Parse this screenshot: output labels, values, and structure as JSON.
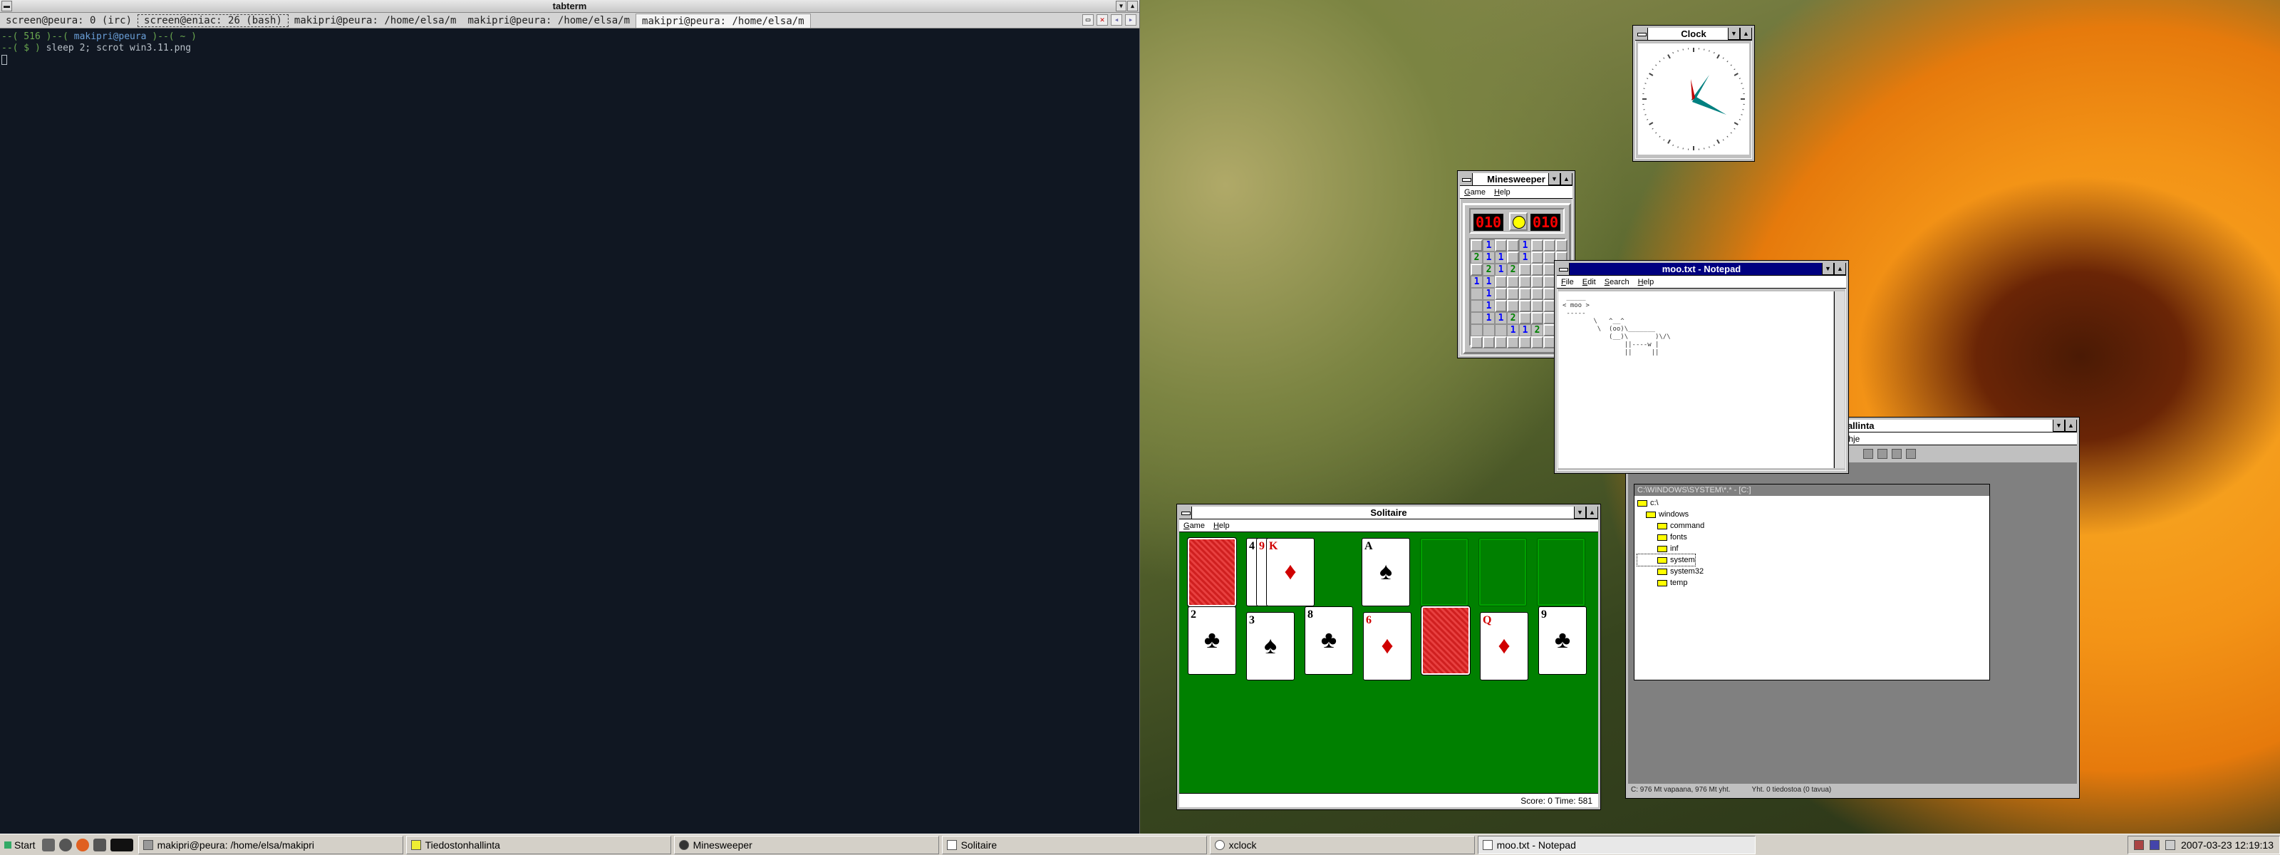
{
  "terminal": {
    "title": "tabterm",
    "tabs": [
      {
        "label": "screen@peura: 0 (irc)"
      },
      {
        "label": "screen@eniac: 26 (bash)"
      },
      {
        "label": "makipri@peura: /home/elsa/m"
      },
      {
        "label": "makipri@peura: /home/elsa/m"
      },
      {
        "label": "makipri@peura: /home/elsa/m"
      }
    ],
    "prompt_line1_a": "--( 516 )--( ",
    "prompt_user": "makipri@peura",
    "prompt_line1_b": " )--( ~ )",
    "prompt_line2_a": "--( $ ) ",
    "command": "sleep 2; scrot win3.11.png"
  },
  "clock": {
    "title": "Clock",
    "hour_angle": 112,
    "minute_angle": 76
  },
  "minesweeper": {
    "title": "Minesweeper",
    "menu": [
      "Game",
      "Help"
    ],
    "mines_left": "010",
    "time": "010",
    "rows": [
      "u1uu1uuu",
      "211u1uuu",
      "u212uuuu",
      "11uuuuuu",
      "o1uuuuuu",
      "o1uuuuuu",
      "o112uuuu",
      "ooo112u1",
      "uuuuuuuu"
    ]
  },
  "notepad": {
    "title": "moo.txt - Notepad",
    "menu": [
      "File",
      "Edit",
      "Search",
      "Help"
    ],
    "content": " _____\n< moo >\n -----\n        \\   ^__^\n         \\  (oo)\\_______\n            (__)\\       )\\/\\\n                ||----w |\n                ||     ||"
  },
  "file_manager": {
    "title": "Tiedostonhallinta",
    "title_visible": "hallinta",
    "menu_visible": "Ohje",
    "inner_title": "C:\\WINDOWS\\SYSTEM\\*.* - [C:]",
    "tree": [
      "c:\\",
      "windows",
      "command",
      "fonts",
      "inf",
      "system",
      "system32",
      "temp"
    ],
    "status_left": "C: 976 Mt vapaana, 976 Mt yht.",
    "status_right": "Yht. 0 tiedostoa (0 tavua)"
  },
  "solitaire": {
    "title": "Solitaire",
    "menu": [
      "Game",
      "Help"
    ],
    "status": "Score: 0 Time: 581",
    "waste": [
      {
        "rank": "4",
        "suit": "♣",
        "color": "black"
      },
      {
        "rank": "9",
        "suit": "♦",
        "color": "red"
      },
      {
        "rank": "K",
        "suit": "♦",
        "color": "red"
      }
    ],
    "foundation": {
      "rank": "A",
      "suit": "♠",
      "color": "black"
    },
    "tableau": [
      {
        "rank": "2",
        "suit": "♣",
        "color": "black"
      },
      {
        "rank": "3",
        "suit": "♠",
        "color": "black"
      },
      {
        "rank": "8",
        "suit": "♣",
        "color": "black"
      },
      {
        "rank": "6",
        "suit": "♦",
        "color": "red"
      },
      {
        "rank": "",
        "suit": "",
        "color": "back"
      },
      {
        "rank": "Q",
        "suit": "♦",
        "color": "red"
      },
      {
        "rank": "9",
        "suit": "♣",
        "color": "black"
      }
    ]
  },
  "taskbar": {
    "start_label": "Start",
    "tasks": [
      {
        "label": "makipri@peura: /home/elsa/makipri"
      },
      {
        "label": "Tiedostonhallinta"
      },
      {
        "label": "Minesweeper"
      },
      {
        "label": "Solitaire"
      },
      {
        "label": "xclock"
      },
      {
        "label": "moo.txt - Notepad"
      }
    ],
    "clock": "2007-03-23 12:19:13"
  }
}
